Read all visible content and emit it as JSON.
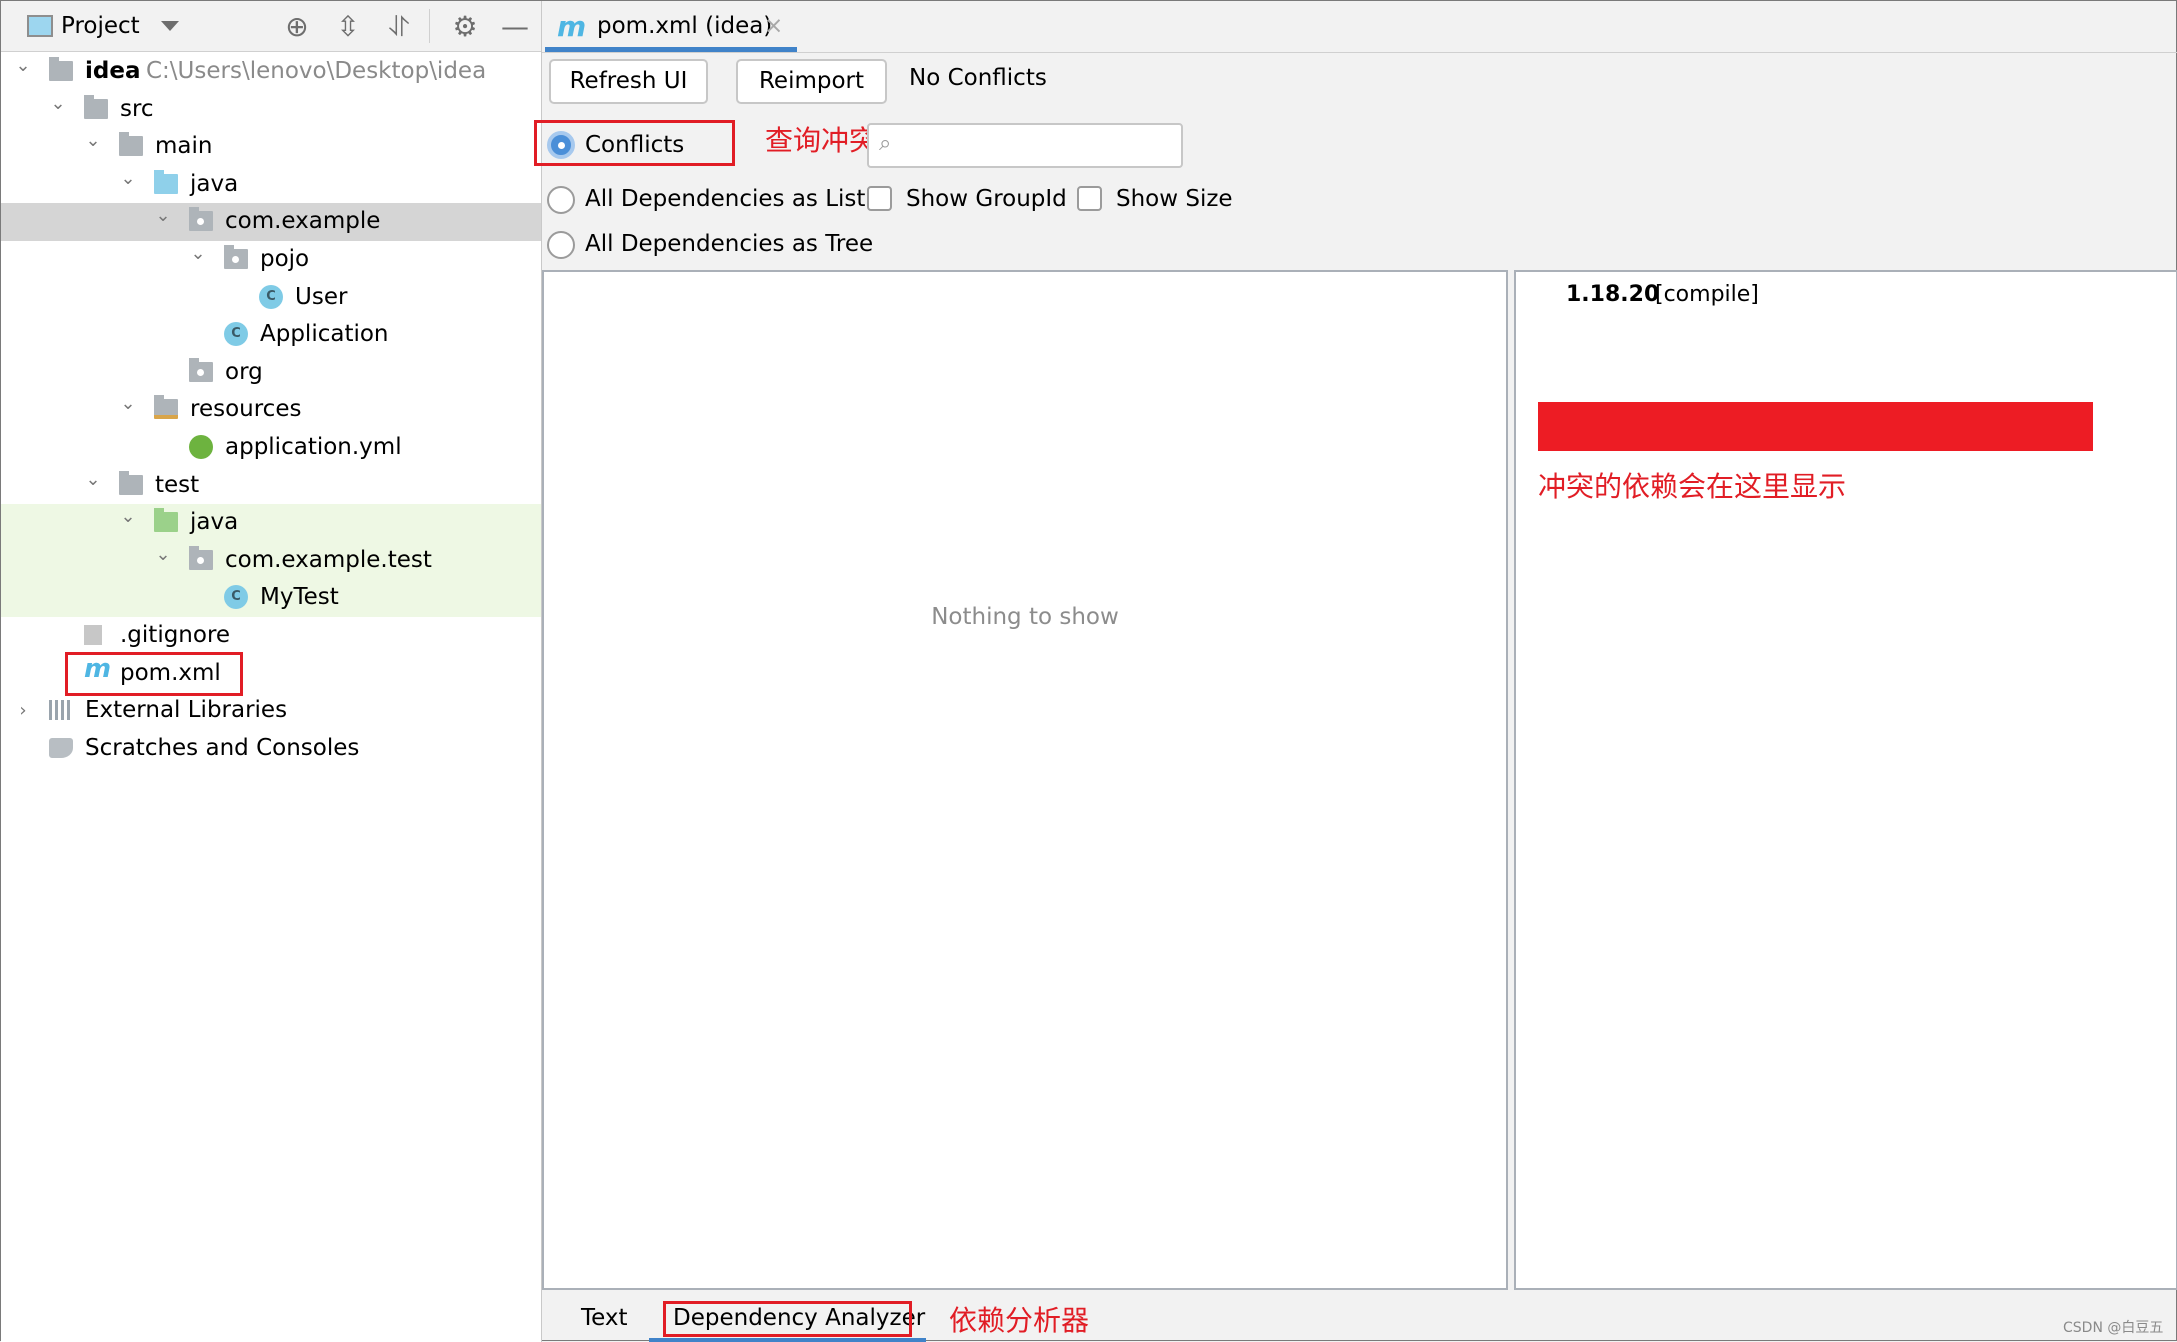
{
  "project_panel": {
    "title": "Project",
    "toolbar_icons": [
      "locate-icon",
      "expand-all-icon",
      "collapse-all-icon",
      "gear-icon",
      "minimize-icon"
    ],
    "tree": [
      {
        "label": "idea",
        "path": "C:\\Users\\lenovo\\Desktop\\idea",
        "depth": 0,
        "expanded": true,
        "icon": "project-folder"
      },
      {
        "label": "src",
        "depth": 1,
        "expanded": true,
        "icon": "folder"
      },
      {
        "label": "main",
        "depth": 2,
        "expanded": true,
        "icon": "folder"
      },
      {
        "label": "java",
        "depth": 3,
        "expanded": true,
        "icon": "source-folder"
      },
      {
        "label": "com.example",
        "depth": 4,
        "expanded": true,
        "icon": "package",
        "selected": true
      },
      {
        "label": "pojo",
        "depth": 5,
        "expanded": true,
        "icon": "package"
      },
      {
        "label": "User",
        "depth": 6,
        "icon": "class"
      },
      {
        "label": "Application",
        "depth": 5,
        "icon": "run-class"
      },
      {
        "label": "org",
        "depth": 4,
        "icon": "package"
      },
      {
        "label": "resources",
        "depth": 3,
        "expanded": true,
        "icon": "resources-folder"
      },
      {
        "label": "application.yml",
        "depth": 4,
        "icon": "spring-config"
      },
      {
        "label": "test",
        "depth": 2,
        "expanded": true,
        "icon": "folder"
      },
      {
        "label": "java",
        "depth": 3,
        "expanded": true,
        "icon": "test-folder"
      },
      {
        "label": "com.example.test",
        "depth": 4,
        "expanded": true,
        "icon": "package"
      },
      {
        "label": "MyTest",
        "depth": 5,
        "icon": "test-class"
      },
      {
        "label": ".gitignore",
        "depth": 1,
        "icon": "ignored-file"
      },
      {
        "label": "pom.xml",
        "depth": 1,
        "icon": "maven",
        "highlighted": true
      },
      {
        "label": "External Libraries",
        "depth": 0,
        "expanded": false,
        "icon": "libraries"
      },
      {
        "label": "Scratches and Consoles",
        "depth": 0,
        "icon": "scratches"
      }
    ]
  },
  "editor": {
    "tab": {
      "label": "pom.xml (idea)",
      "icon": "maven-icon"
    },
    "buttons": {
      "refresh": "Refresh UI",
      "reimport": "Reimport"
    },
    "status": "No Conflicts",
    "modes": [
      {
        "label": "Conflicts",
        "selected": true
      },
      {
        "label": "All Dependencies as List",
        "selected": false
      },
      {
        "label": "All Dependencies as Tree",
        "selected": false
      }
    ],
    "checkboxes": [
      {
        "label": "Show GroupId",
        "checked": false
      },
      {
        "label": "Show Size",
        "checked": false
      }
    ],
    "search": {
      "value": "",
      "placeholder": ""
    },
    "left_panel_empty": "Nothing to show",
    "right_panel": {
      "version": "1.18.20",
      "scope": "[compile]"
    },
    "bottom_tabs": [
      {
        "label": "Text",
        "active": false
      },
      {
        "label": "Dependency Analyzer",
        "active": true
      }
    ]
  },
  "annotations": {
    "query_conflicts": "查询冲突的",
    "conflicts_shown_here": "冲突的依赖会在这里显示",
    "dependency_analyzer": "依赖分析器",
    "red_color": "#e11d25"
  },
  "watermark": "CSDN @白豆五",
  "colors": {
    "accent": "#4083c9",
    "selection": "#d5d5d5",
    "test_bg": "#eef8e4"
  }
}
